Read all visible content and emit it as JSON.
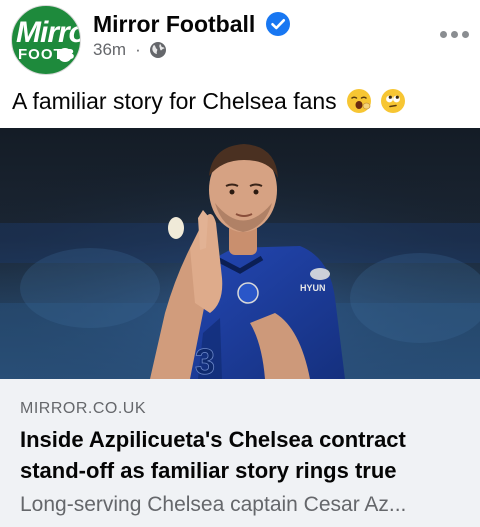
{
  "post": {
    "page_name": "Mirror Football",
    "avatar_text": "Mirror",
    "avatar_sub": "FOOTBALL",
    "verified": true,
    "time": "36m",
    "separator": "·",
    "audience_icon": "globe-icon",
    "more_icon": "more-options-icon",
    "caption": "A familiar story for Chelsea fans",
    "caption_emojis": [
      "yawning-face-emoji",
      "rolling-eyes-face-emoji"
    ]
  },
  "photo": {
    "subject": "chelsea-player-photo",
    "shirt_number": "3"
  },
  "link_preview": {
    "domain": "MIRROR.CO.UK",
    "headline": "Inside Azpilicueta's Chelsea contract stand-off as familiar story rings true",
    "description": "Long-serving Chelsea captain Cesar Az..."
  },
  "colors": {
    "verified_blue": "#1877f2",
    "avatar_green": "#1e8a3c",
    "secondary_text": "#65676b",
    "preview_bg": "#f0f2f5",
    "chelsea_blue": "#1d3fa8"
  }
}
